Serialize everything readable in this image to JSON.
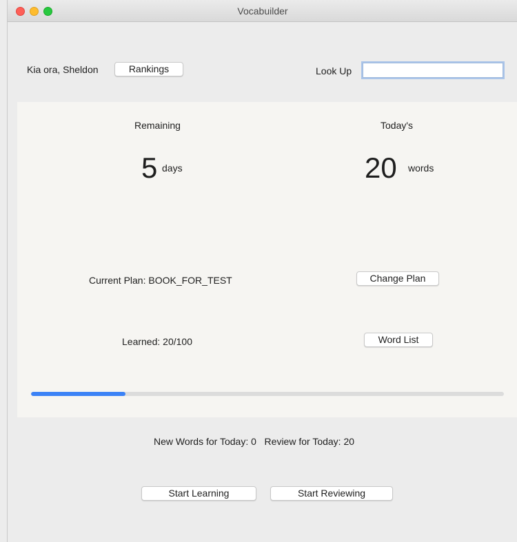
{
  "window": {
    "title": "Vocabuilder"
  },
  "header": {
    "greeting": "Kia ora, Sheldon",
    "rankings_label": "Rankings",
    "lookup_label": "Look Up",
    "lookup_value": ""
  },
  "stats": {
    "remaining_label": "Remaining",
    "remaining_value": "5",
    "remaining_unit": "days",
    "today_label": "Today's",
    "today_value": "20",
    "today_unit": "words"
  },
  "plan": {
    "current_plan_text": "Current Plan: BOOK_FOR_TEST",
    "change_plan_label": "Change Plan",
    "learned_text": "Learned: 20/100",
    "word_list_label": "Word List",
    "progress_fraction": 0.2
  },
  "footer": {
    "today_counts_text": "New Words for Today: 0   Review for Today: 20",
    "start_learning_label": "Start Learning",
    "start_reviewing_label": "Start Reviewing"
  },
  "colors": {
    "progress_fill": "#3b82f6",
    "panel_background": "#f6f5f2",
    "window_background": "#ececec"
  }
}
